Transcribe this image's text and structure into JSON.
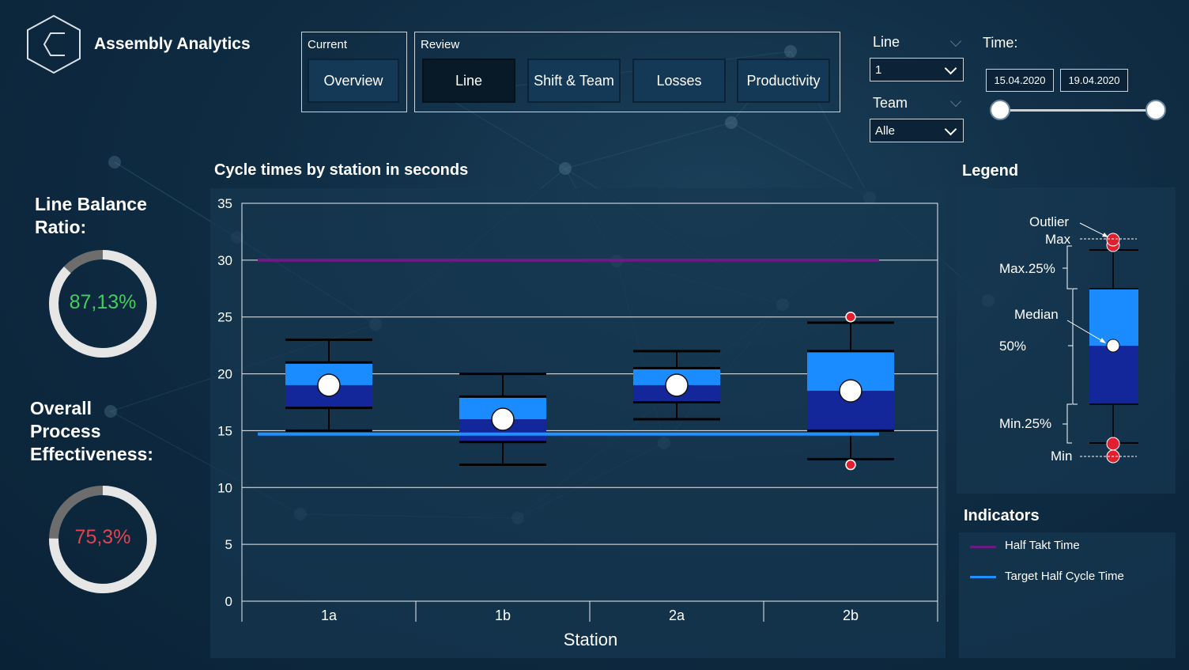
{
  "app": {
    "title": "Assembly Analytics"
  },
  "nav": {
    "current_label": "Current",
    "review_label": "Review",
    "buttons": {
      "overview": "Overview",
      "line": "Line",
      "shift_team": "Shift & Team",
      "losses": "Losses",
      "productivity": "Productivity"
    },
    "active": "Line"
  },
  "filters": {
    "line_label": "Line",
    "line_value": "1",
    "team_label": "Team",
    "team_value": "Alle",
    "time_label": "Time:",
    "date_from": "15.04.2020",
    "date_to": "19.04.2020"
  },
  "kpis": {
    "line_balance": {
      "title_line1": "Line Balance",
      "title_line2": "Ratio:",
      "value_text": "87,13%",
      "value": 0.8713,
      "color": "#3fcf5a"
    },
    "ope": {
      "title_line1": "Overall",
      "title_line2": "Process",
      "title_line3": "Effectiveness:",
      "value_text": "75,3%",
      "value": 0.753,
      "color": "#e04452"
    }
  },
  "chart_data": {
    "type": "boxplot",
    "title": "Cycle times by station in seconds",
    "xlabel": "Station",
    "ylabel": "",
    "ylim": [
      0,
      35
    ],
    "yticks": [
      0,
      5,
      10,
      15,
      20,
      25,
      30,
      35
    ],
    "grid": true,
    "categories": [
      "1a",
      "1b",
      "2a",
      "2b"
    ],
    "boxes": [
      {
        "station": "1a",
        "min": 15,
        "q1": 17,
        "median": 19,
        "q3": 21,
        "max": 23,
        "outliers": []
      },
      {
        "station": "1b",
        "min": 12,
        "q1": 14,
        "median": 16,
        "q3": 18,
        "max": 20,
        "outliers": []
      },
      {
        "station": "2a",
        "min": 16,
        "q1": 17.5,
        "median": 19,
        "q3": 20.5,
        "max": 22,
        "outliers": []
      },
      {
        "station": "2b",
        "min": 12.5,
        "q1": 15,
        "median": 18.5,
        "q3": 22,
        "max": 24.5,
        "outliers": [
          25,
          12
        ]
      }
    ],
    "reference_lines": [
      {
        "name": "Half Takt Time",
        "value": 30,
        "color": "#6b1b82"
      },
      {
        "name": "Target Half Cycle Time",
        "value": 14.7,
        "color": "#1e90ff"
      }
    ],
    "colors": {
      "upper_box": "#1a8cff",
      "lower_box": "#13279a",
      "outlier": "#e0202e"
    }
  },
  "legend": {
    "title": "Legend",
    "labels": {
      "outlier": "Outlier",
      "max": "Max",
      "max25": "Max.25%",
      "median": "Median",
      "fifty": "50%",
      "min25": "Min.25%",
      "min": "Min"
    }
  },
  "indicators": {
    "title": "Indicators",
    "items": [
      {
        "label": "Half Takt Time",
        "color": "#6b1b82"
      },
      {
        "label": "Target Half Cycle Time",
        "color": "#1e90ff"
      }
    ]
  }
}
